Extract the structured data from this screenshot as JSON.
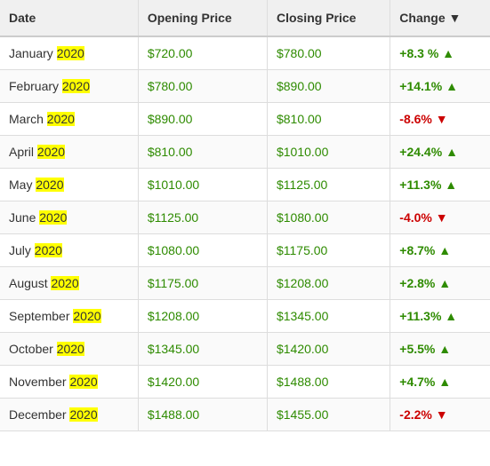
{
  "table": {
    "headers": [
      {
        "label": "Date",
        "id": "date-header"
      },
      {
        "label": "Opening Price",
        "id": "opening-price-header"
      },
      {
        "label": "Closing Price",
        "id": "closing-price-header"
      },
      {
        "label": "Change ▼",
        "id": "change-header"
      }
    ],
    "rows": [
      {
        "month": "January",
        "year": "2020",
        "opening": "$720.00",
        "closing": "$780.00",
        "change": "+8.3 %",
        "positive": true
      },
      {
        "month": "February",
        "year": "2020",
        "opening": "$780.00",
        "closing": "$890.00",
        "change": "+14.1%",
        "positive": true
      },
      {
        "month": "March",
        "year": "2020",
        "opening": "$890.00",
        "closing": "$810.00",
        "change": "-8.6%",
        "positive": false
      },
      {
        "month": "April",
        "year": "2020",
        "opening": "$810.00",
        "closing": "$1010.00",
        "change": "+24.4%",
        "positive": true
      },
      {
        "month": "May",
        "year": "2020",
        "opening": "$1010.00",
        "closing": "$1125.00",
        "change": "+11.3%",
        "positive": true
      },
      {
        "month": "June",
        "year": "2020",
        "opening": "$1125.00",
        "closing": "$1080.00",
        "change": "-4.0%",
        "positive": false
      },
      {
        "month": "July",
        "year": "2020",
        "opening": "$1080.00",
        "closing": "$1175.00",
        "change": "+8.7%",
        "positive": true
      },
      {
        "month": "August",
        "year": "2020",
        "opening": "$1175.00",
        "closing": "$1208.00",
        "change": "+2.8%",
        "positive": true
      },
      {
        "month": "September",
        "year": "2020",
        "opening": "$1208.00",
        "closing": "$1345.00",
        "change": "+11.3%",
        "positive": true
      },
      {
        "month": "October",
        "year": "2020",
        "opening": "$1345.00",
        "closing": "$1420.00",
        "change": "+5.5%",
        "positive": true
      },
      {
        "month": "November",
        "year": "2020",
        "opening": "$1420.00",
        "closing": "$1488.00",
        "change": "+4.7%",
        "positive": true
      },
      {
        "month": "December",
        "year": "2020",
        "opening": "$1488.00",
        "closing": "$1455.00",
        "change": "-2.2%",
        "positive": false
      }
    ]
  }
}
